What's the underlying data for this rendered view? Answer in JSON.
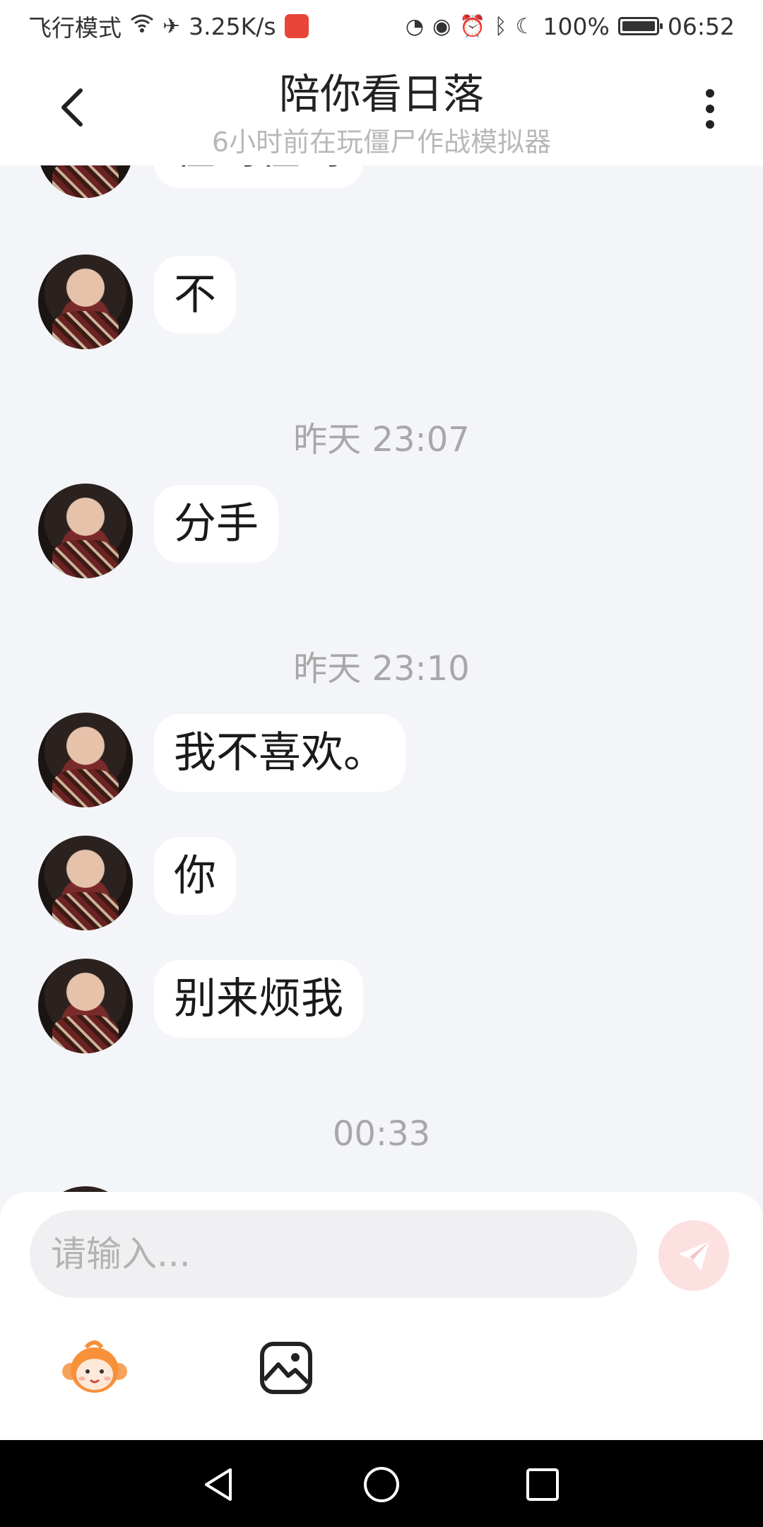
{
  "status_bar": {
    "carrier": "飞行模式",
    "net_speed": "3.25K/s",
    "battery_text": "100%",
    "time": "06:52"
  },
  "header": {
    "title": "陪你看日落",
    "subtitle": "6小时前在玩僵尸作战模拟器"
  },
  "messages": [
    {
      "type": "text",
      "text": "在吗在吗"
    },
    {
      "type": "text",
      "text": "不"
    },
    {
      "type": "time",
      "text": "昨天 23:07"
    },
    {
      "type": "text",
      "text": "分手"
    },
    {
      "type": "time",
      "text": "昨天 23:10"
    },
    {
      "type": "text",
      "text": "我不喜欢。"
    },
    {
      "type": "text",
      "text": "你"
    },
    {
      "type": "text",
      "text": "别来烦我"
    },
    {
      "type": "time",
      "text": "00:33"
    }
  ],
  "input": {
    "placeholder": "请输入..."
  },
  "icons": {
    "send": "paper-plane-icon",
    "emoji": "monkey-emoji-icon",
    "image": "image-icon"
  },
  "colors": {
    "background": "#f4f5f9",
    "bubble": "#ffffff",
    "send_button": "#fde0e0",
    "timestamp": "#a8a8a8"
  }
}
